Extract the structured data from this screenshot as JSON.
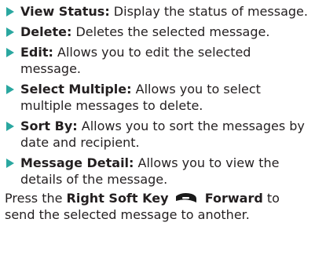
{
  "items": [
    {
      "term": "View Status:",
      "desc": " Display the status of message."
    },
    {
      "term": "Delete:",
      "desc": " Deletes the selected message."
    },
    {
      "term": "Edit:",
      "desc": " Allows you to edit the selected message."
    },
    {
      "term": "Select Multiple:",
      "desc": " Allows you to select multiple messages to delete."
    },
    {
      "term": "Sort By:",
      "desc": " Allows you to sort the messages by date and recipient."
    },
    {
      "term": "Message Detail:",
      "desc": " Allows you to view the details of the message."
    }
  ],
  "footer": {
    "prefix": "Press the ",
    "key_name": "Right Soft Key",
    "key_icon": "right-soft-key-icon",
    "action": "Forward",
    "suffix": " to send the selected message to another."
  },
  "colors": {
    "bullet": "#2aa7a0",
    "text": "#231f20",
    "key": "#1a1a1a"
  }
}
